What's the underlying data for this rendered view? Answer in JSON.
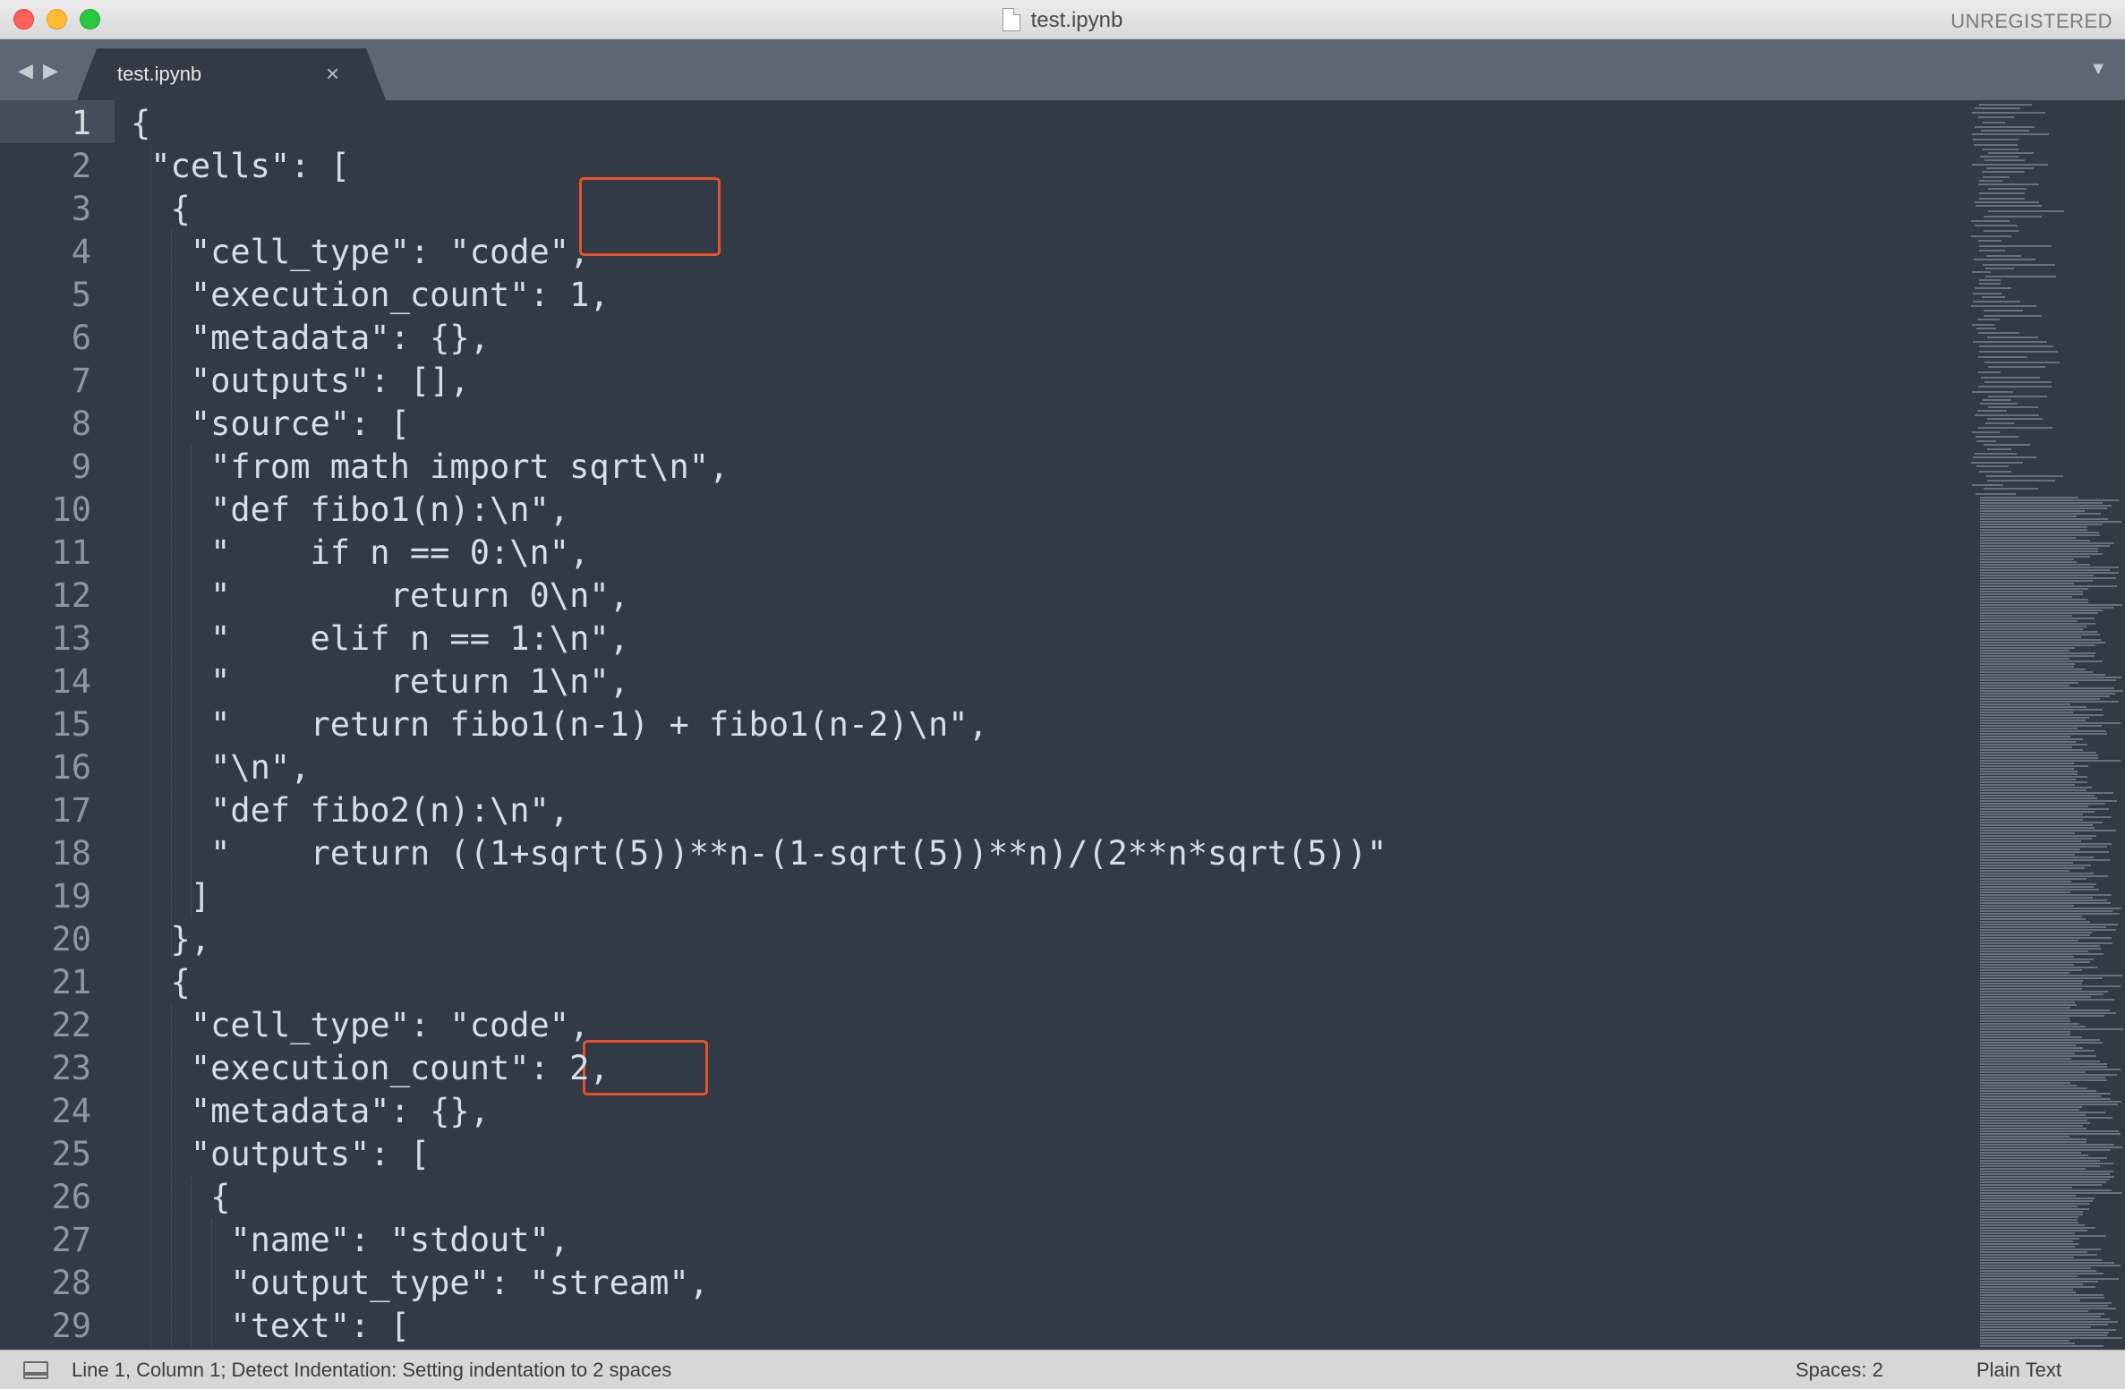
{
  "window": {
    "title": "test.ipynb",
    "registration": "UNREGISTERED"
  },
  "tabbar": {
    "nav_back": "◀",
    "nav_forward": "▶",
    "tabs": [
      {
        "label": "test.ipynb",
        "close": "×"
      }
    ],
    "dropdown": "▼"
  },
  "editor": {
    "line_numbers": [
      "1",
      "2",
      "3",
      "4",
      "5",
      "6",
      "7",
      "8",
      "9",
      "10",
      "11",
      "12",
      "13",
      "14",
      "15",
      "16",
      "17",
      "18",
      "19",
      "20",
      "21",
      "22",
      "23",
      "24",
      "25",
      "26",
      "27",
      "28",
      "29"
    ],
    "lines": [
      "{",
      " \"cells\": [",
      "  {",
      "   \"cell_type\": \"code\",",
      "   \"execution_count\": 1,",
      "   \"metadata\": {},",
      "   \"outputs\": [],",
      "   \"source\": [",
      "    \"from math import sqrt\\n\",",
      "    \"def fibo1(n):\\n\",",
      "    \"    if n == 0:\\n\",",
      "    \"        return 0\\n\",",
      "    \"    elif n == 1:\\n\",",
      "    \"        return 1\\n\",",
      "    \"    return fibo1(n-1) + fibo1(n-2)\\n\",",
      "    \"\\n\",",
      "    \"def fibo2(n):\\n\",",
      "    \"    return ((1+sqrt(5))**n-(1-sqrt(5))**n)/(2**n*sqrt(5))\"",
      "   ]",
      "  },",
      "  {",
      "   \"cell_type\": \"code\",",
      "   \"execution_count\": 2,",
      "   \"metadata\": {},",
      "   \"outputs\": [",
      "    {",
      "     \"name\": \"stdout\",",
      "     \"output_type\": \"stream\",",
      "     \"text\": ["
    ]
  },
  "statusbar": {
    "message": "Line 1, Column 1; Detect Indentation: Setting indentation to 2 spaces",
    "spaces": "Spaces: 2",
    "syntax": "Plain Text"
  },
  "colors": {
    "editor_bg": "#323a45",
    "tabbar_bg": "#5d6672",
    "highlight_box": "#e8512d",
    "text": "#d8dee9",
    "line_number": "#8f969f"
  },
  "icons": {
    "file": "document-icon",
    "panel_toggle": "panel-icon"
  }
}
